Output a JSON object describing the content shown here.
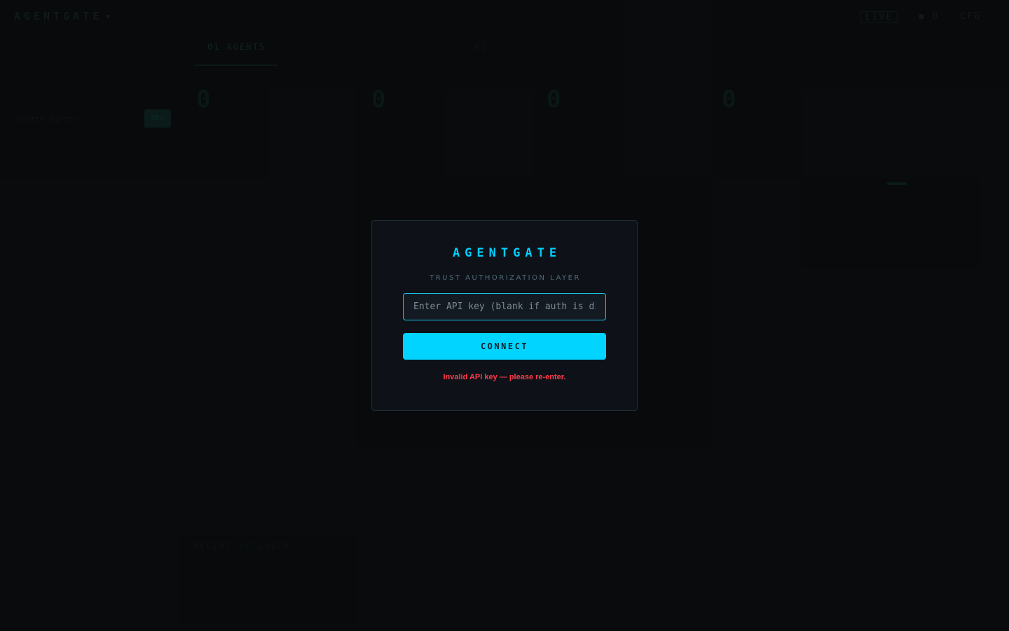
{
  "background": {
    "logo": "AGENTGATE",
    "logo_caret": "▾",
    "top_right": {
      "live": "LIVE",
      "item_2": "● 0",
      "item_3": "CFG"
    },
    "tabs": [
      {
        "label": "01 AGENTS",
        "state": "active"
      },
      {
        "label": "02",
        "state": "faint"
      }
    ],
    "stats": [
      "0",
      "0",
      "0",
      "0"
    ],
    "side_label": "search agents...",
    "side_button": "NEW",
    "footer_label": "RECENT ACTIVITY"
  },
  "modal": {
    "title": "AGENTGATE",
    "subtitle": "TRUST AUTHORIZATION LAYER",
    "api_input": {
      "value": "",
      "placeholder": "Enter API key (blank if auth is disabled)"
    },
    "connect_label": "CONNECT",
    "error": "Invalid API key — please re-enter."
  },
  "colors": {
    "accent": "#00d4ff",
    "error": "#ff3b4a",
    "background": "#0a0c0f",
    "modal_bg": "#0e1218"
  }
}
